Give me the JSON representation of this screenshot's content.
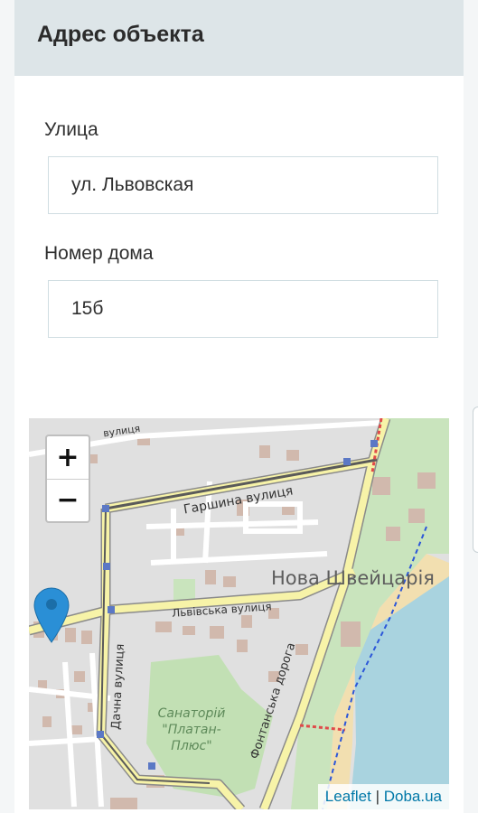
{
  "card": {
    "title": "Адрес объекта"
  },
  "street": {
    "label": "Улица",
    "value": "ул. Львовская"
  },
  "house": {
    "label": "Номер дома",
    "value": "15б"
  },
  "map": {
    "zoom_in": "+",
    "zoom_out": "−",
    "attribution": {
      "leaflet": "Leaflet",
      "separator": "|",
      "provider": "Doba.ua"
    },
    "labels": {
      "garshina": "Гаршина вулиця",
      "lvivska": "Львівська вулиця",
      "dachna": "Дачна вулиця",
      "fontanska": "Фонтанська дорога",
      "district": "Нова Швейцарія",
      "sanatorium_1": "Санаторій",
      "sanatorium_2": "\"Платан-",
      "sanatorium_3": "Плюс\"",
      "top_street": "вулиця"
    },
    "colors": {
      "road": "#f7f3a8",
      "park": "#c9e4bd",
      "water": "#a9d3df",
      "beach": "#f2dfb0",
      "marker": "#2a8fd6"
    }
  }
}
